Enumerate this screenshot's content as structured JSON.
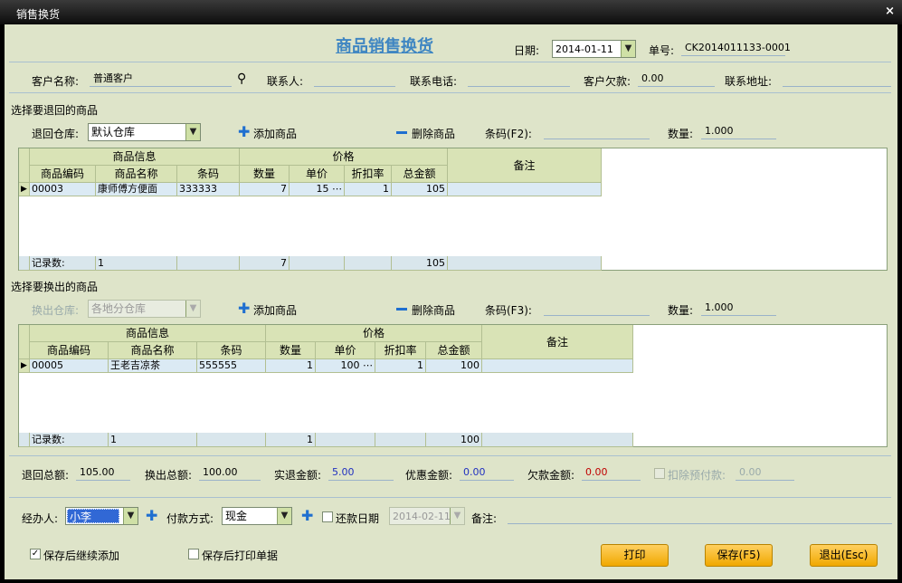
{
  "window": {
    "title": "销售换货",
    "close": "×"
  },
  "header": {
    "title": "商品销售换货",
    "date_label": "日期:",
    "date_value": "2014-01-11",
    "order_label": "单号:",
    "order_value": "CK2014011133-0001"
  },
  "customer": {
    "name_label": "客户名称:",
    "name_value": "普通客户",
    "contact_label": "联系人:",
    "contact_value": "",
    "phone_label": "联系电话:",
    "phone_value": "",
    "debt_label": "客户欠款:",
    "debt_value": "0.00",
    "address_label": "联系地址:",
    "address_value": ""
  },
  "return_section": {
    "title": "选择要退回的商品",
    "warehouse_label": "退回仓库:",
    "warehouse_value": "默认仓库",
    "add_label": "添加商品",
    "delete_label": "删除商品",
    "barcode_label": "条码(F2):",
    "barcode_value": "",
    "qty_label": "数量:",
    "qty_value": "1.000",
    "table": {
      "group_info": "商品信息",
      "group_price": "价格",
      "col_code": "商品编码",
      "col_name": "商品名称",
      "col_barcode": "条码",
      "col_qty": "数量",
      "col_unit": "单价",
      "col_discount": "折扣率",
      "col_total": "总金额",
      "col_note": "备注",
      "rows": [
        {
          "code": "00003",
          "name": "康师傅方便面",
          "barcode": "333333",
          "qty": "7",
          "unit": "15",
          "discount": "1",
          "total": "105",
          "note": ""
        }
      ],
      "footer": {
        "label": "记录数:",
        "count": "1",
        "qty": "7",
        "total": "105"
      }
    }
  },
  "exchange_section": {
    "title": "选择要换出的商品",
    "warehouse_label": "换出仓库:",
    "warehouse_value": "各地分仓库",
    "add_label": "添加商品",
    "delete_label": "删除商品",
    "barcode_label": "条码(F3):",
    "barcode_value": "",
    "qty_label": "数量:",
    "qty_value": "1.000",
    "table": {
      "group_info": "商品信息",
      "group_price": "价格",
      "col_code": "商品编码",
      "col_name": "商品名称",
      "col_barcode": "条码",
      "col_qty": "数量",
      "col_unit": "单价",
      "col_discount": "折扣率",
      "col_total": "总金额",
      "col_note": "备注",
      "rows": [
        {
          "code": "00005",
          "name": "王老吉凉茶",
          "barcode": "555555",
          "qty": "1",
          "unit": "100",
          "discount": "1",
          "total": "100",
          "note": ""
        }
      ],
      "footer": {
        "label": "记录数:",
        "count": "1",
        "qty": "1",
        "total": "100"
      }
    }
  },
  "totals": {
    "return_label": "退回总额:",
    "return_value": "105.00",
    "exchange_label": "换出总额:",
    "exchange_value": "100.00",
    "refund_label": "实退金额:",
    "refund_value": "5.00",
    "discount_label": "优惠金额:",
    "discount_value": "0.00",
    "owe_label": "欠款金额:",
    "owe_value": "0.00",
    "deduct_label": "扣除预付款:",
    "deduct_value": "0.00"
  },
  "payment": {
    "agent_label": "经办人:",
    "agent_value": "小李",
    "method_label": "付款方式:",
    "method_value": "现金",
    "repay_label": "还款日期",
    "repay_value": "2014-02-11",
    "note_label": "备注:",
    "note_value": ""
  },
  "options": {
    "continue_label": "保存后继续添加",
    "continue_checked": "✓",
    "print_label": "保存后打印单据"
  },
  "buttons": {
    "print": "打印",
    "save": "保存(F5)",
    "exit": "退出(Esc)"
  },
  "colors": {
    "title": "#3f86c2",
    "panel": "#dee4c9",
    "button": "#f0a800"
  }
}
